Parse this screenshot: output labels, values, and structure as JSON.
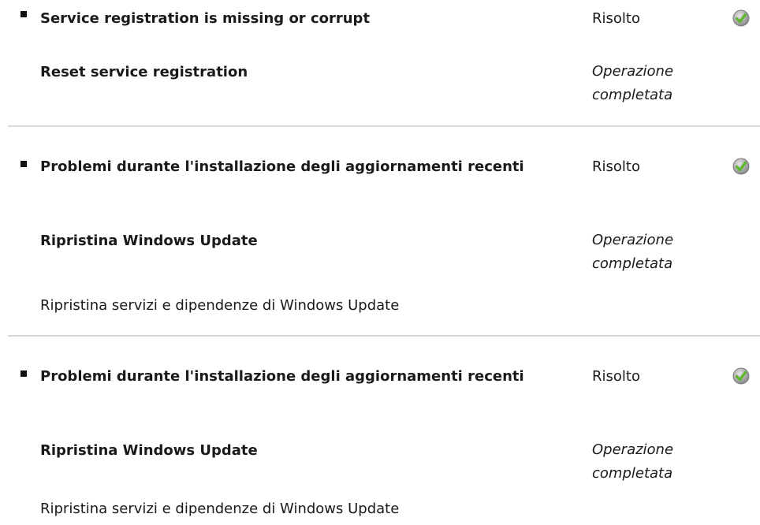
{
  "entries": [
    {
      "problem_title": "Service registration is missing or corrupt",
      "status": "Risolto",
      "status_icon": "green-check-icon",
      "fix_title": "Reset service registration",
      "fix_status": "Operazione completata",
      "description": ""
    },
    {
      "problem_title": "Problemi durante l'installazione degli aggiornamenti recenti",
      "status": "Risolto",
      "status_icon": "green-check-icon",
      "fix_title": "Ripristina Windows Update",
      "fix_status": "Operazione completata",
      "description": "Ripristina servizi e dipendenze di Windows Update"
    },
    {
      "problem_title": "Problemi durante l'installazione degli aggiornamenti recenti",
      "status": "Risolto",
      "status_icon": "green-check-icon",
      "fix_title": "Ripristina Windows Update",
      "fix_status": "Operazione completata",
      "description": "Ripristina servizi e dipendenze di Windows Update"
    }
  ],
  "colors": {
    "check_green": "#5cb82a",
    "divider": "#d8d8d8"
  }
}
